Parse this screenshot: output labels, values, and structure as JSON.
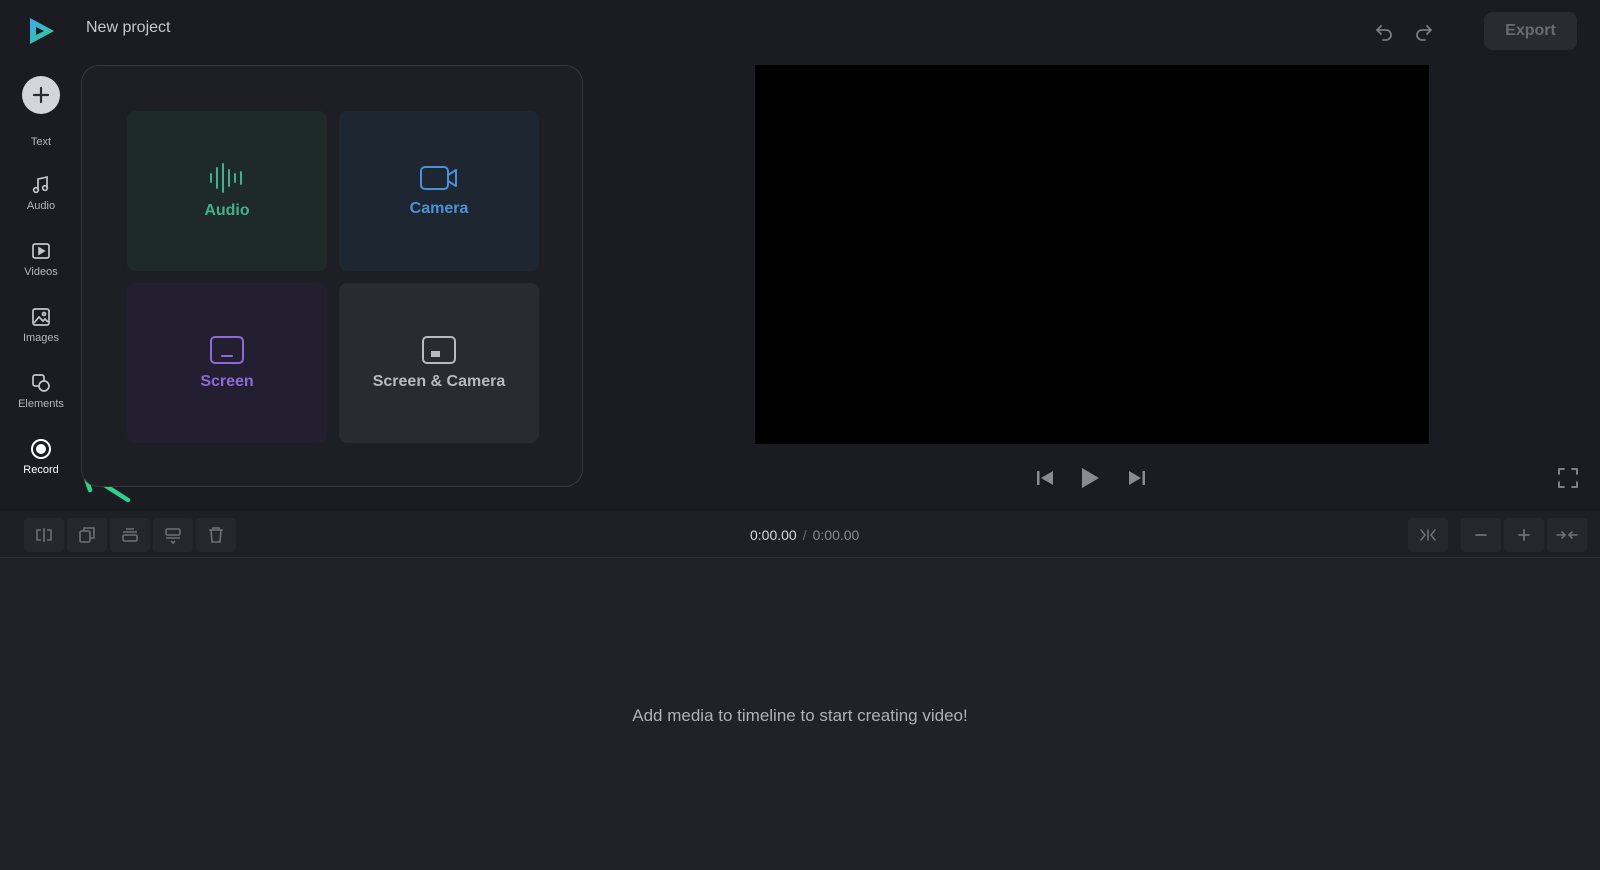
{
  "app": {
    "project_title": "New project",
    "export_label": "Export",
    "accent_color": "#2fd08a"
  },
  "sidebar": {
    "items": [
      {
        "label": "Text",
        "icon": "plus-icon"
      },
      {
        "label": "Audio",
        "icon": "music-note-icon"
      },
      {
        "label": "Videos",
        "icon": "video-play-icon"
      },
      {
        "label": "Images",
        "icon": "image-icon"
      },
      {
        "label": "Elements",
        "icon": "shapes-icon"
      },
      {
        "label": "Record",
        "icon": "record-icon"
      }
    ]
  },
  "record_panel": {
    "options": [
      {
        "label": "Audio",
        "icon": "waveform-icon",
        "color": "#43b08a"
      },
      {
        "label": "Camera",
        "icon": "camera-icon",
        "color": "#4a92d8"
      },
      {
        "label": "Screen",
        "icon": "screen-icon",
        "color": "#8d6ad8"
      },
      {
        "label": "Screen & Camera",
        "icon": "screen-camera-icon",
        "color": "#b9bac0"
      }
    ]
  },
  "timeline": {
    "current_time": "0:00.00",
    "separator": "/",
    "total_time": "0:00.00",
    "empty_message": "Add media to timeline to start creating video!"
  }
}
